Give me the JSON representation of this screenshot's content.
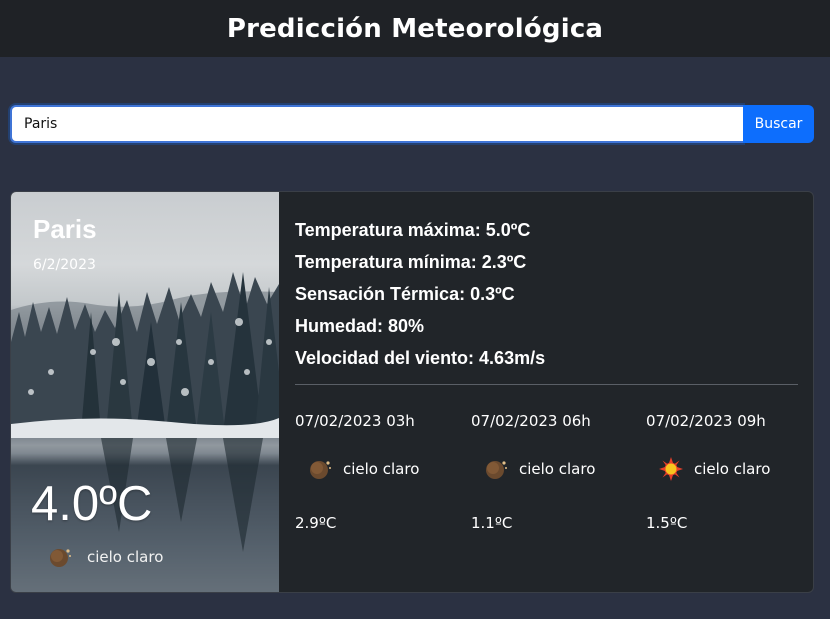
{
  "header": {
    "title": "Predicción Meteorológica"
  },
  "search": {
    "value": "Paris",
    "button_label": "Buscar"
  },
  "current": {
    "city": "Paris",
    "date": "6/2/2023",
    "temperature": "4.0ºC",
    "description": "cielo claro",
    "icon": "moon-clear-icon"
  },
  "details": {
    "max_temp": "Temperatura máxima: 5.0ºC",
    "min_temp": "Temperatura mínima: 2.3ºC",
    "feels_like": "Sensación Térmica: 0.3ºC",
    "humidity": "Humedad: 80%",
    "wind": "Velocidad del viento: 4.63m/s"
  },
  "forecast": [
    {
      "time": "07/02/2023 03h",
      "description": "cielo claro",
      "temp": "2.9ºC",
      "icon": "moon-clear-icon"
    },
    {
      "time": "07/02/2023 06h",
      "description": "cielo claro",
      "temp": "1.1ºC",
      "icon": "moon-clear-icon"
    },
    {
      "time": "07/02/2023 09h",
      "description": "cielo claro",
      "temp": "1.5ºC",
      "icon": "sun-clear-icon"
    }
  ],
  "colors": {
    "accent": "#0d6efd",
    "background": "#2b3142",
    "card": "#212529",
    "header": "#1f2226"
  }
}
